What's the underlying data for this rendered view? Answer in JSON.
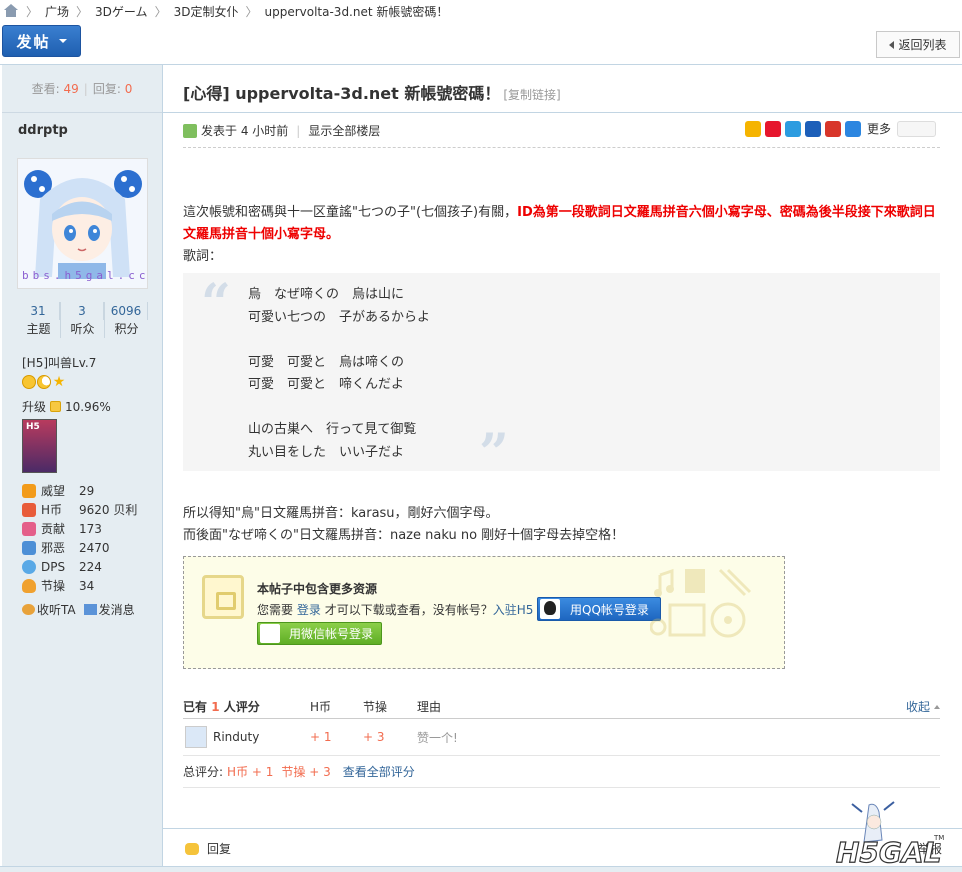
{
  "breadcrumb": {
    "items": [
      "广场",
      "3Dゲーム",
      "3D定制女仆",
      "uppervolta-3d.net 新帳號密碼！"
    ]
  },
  "toolbar": {
    "post_label": "发帖",
    "back_label": "返回列表"
  },
  "sidebar": {
    "views_label": "查看:",
    "views": "49",
    "replies_label": "回复:",
    "replies": "0",
    "username": "ddrptp",
    "avatar_text": "bbs.h5gal.cc",
    "counts": [
      {
        "value": "31",
        "label": "主题"
      },
      {
        "value": "3",
        "label": "听众"
      },
      {
        "value": "6096",
        "label": "积分"
      }
    ],
    "level": "[H5]叫兽Lv.7",
    "upgrade_label": "升级",
    "upgrade_pct": "10.96%",
    "medal_text": "H5",
    "attrs": [
      {
        "icon": "crown-icon",
        "label": "威望",
        "value": "29",
        "color": "#f29b1a"
      },
      {
        "icon": "coin-icon",
        "label": "H币",
        "value": "9620 贝利",
        "color": "#e85c3a"
      },
      {
        "icon": "heart-icon",
        "label": "贡献",
        "value": "173",
        "color": "#e45f8a"
      },
      {
        "icon": "puzzle-icon",
        "label": "邪恶",
        "value": "2470",
        "color": "#4d8fd6"
      },
      {
        "icon": "star-icon",
        "label": "DPS",
        "value": "224",
        "color": "#5aa9e6"
      },
      {
        "icon": "bulb-icon",
        "label": "节操",
        "value": "34",
        "color": "#f0a12f"
      }
    ],
    "follow_label": "收听TA",
    "message_label": "发消息"
  },
  "post": {
    "title": "[心得] uppervolta-3d.net 新帳號密碼！",
    "copy_link": "[复制链接]",
    "posted": "发表于 4 小时前",
    "show_all": "显示全部楼层",
    "share_more": "更多",
    "p1_normal": "這次帳號和密碼與十一区童謠\"七つの子\"(七個孩子)有關，",
    "p1_red": "ID為第一段歌詞日文羅馬拼音六個小寫字母、密碼為後半段接下來歌詞日文羅馬拼音十個小寫字母。",
    "lyrics_label": "歌詞：",
    "quote_lines": [
      "烏　なぜ啼くの　烏は山に",
      "可愛い七つの　子があるからよ",
      "",
      "可愛　可愛と　烏は啼くの",
      "可愛　可愛と　啼くんだよ",
      "",
      "山の古巣へ　行って見て御覧",
      "丸い目をした　いい子だよ"
    ],
    "p2_lines": [
      "所以得知\"烏\"日文羅馬拼音：karasu，剛好六個字母。",
      "而後面\"なぜ啼くの\"日文羅馬拼音：naze naku no 剛好十個字母去掉空格！"
    ]
  },
  "lockbox": {
    "heading": "本帖子中包含更多资源",
    "need": "您需要",
    "login": "登录",
    "after_login": "才可以下载或查看，没有帐号？",
    "register": "入驻H5",
    "qq_label": "用QQ帐号登录",
    "wechat_label": "用微信帐号登录"
  },
  "rating": {
    "prefix": "已有",
    "count": "1",
    "suffix": "人评分",
    "col_h": "H币",
    "col_jc": "节操",
    "col_reason": "理由",
    "collapse": "收起",
    "rows": [
      {
        "user": "Rinduty",
        "h": "+ 1",
        "jc": "+ 3",
        "reason": "赞一个!"
      }
    ],
    "total_label": "总评分:",
    "total_h": "H币 + 1",
    "total_jc": "节操 + 3",
    "view_all": "查看全部评分"
  },
  "footer": {
    "reply_label": "回复",
    "report_label": "举报",
    "logo_text": "H5GAL",
    "logo_tm": "TM"
  }
}
